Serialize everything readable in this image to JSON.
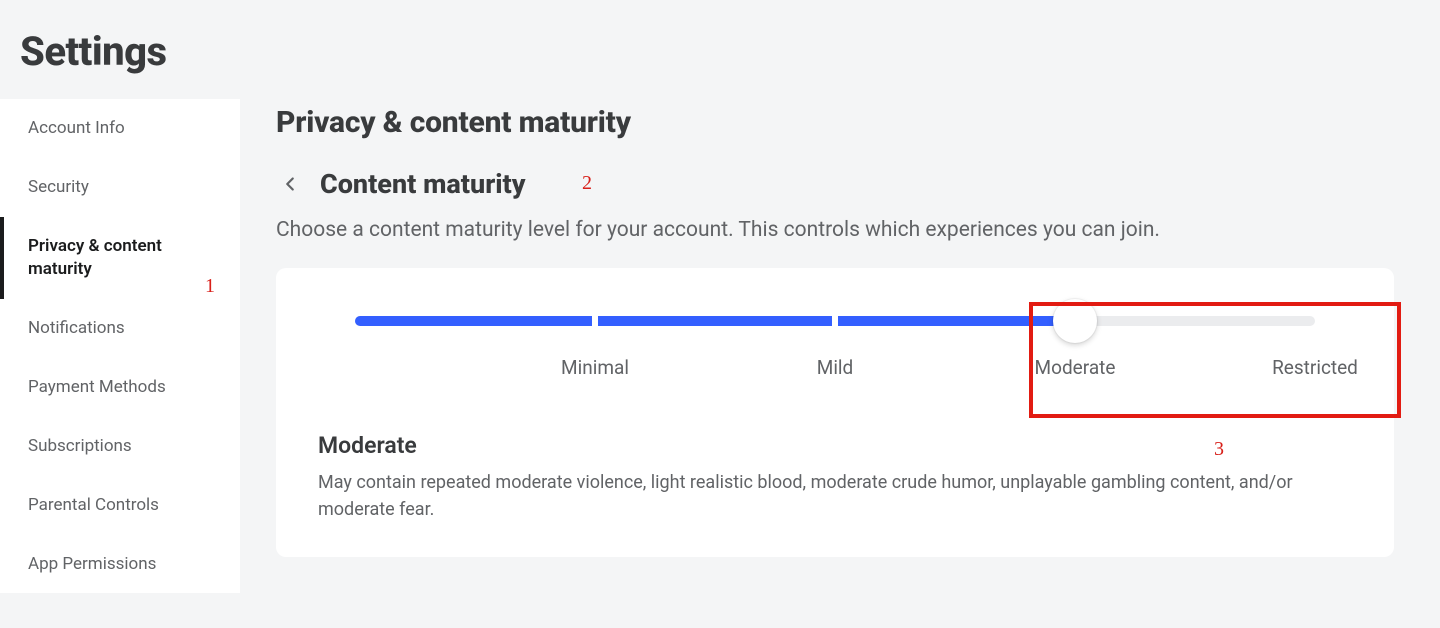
{
  "page_title": "Settings",
  "sidebar": {
    "items": [
      {
        "label": "Account Info",
        "active": false
      },
      {
        "label": "Security",
        "active": false
      },
      {
        "label": "Privacy & content maturity",
        "active": true
      },
      {
        "label": "Notifications",
        "active": false
      },
      {
        "label": "Payment Methods",
        "active": false
      },
      {
        "label": "Subscriptions",
        "active": false
      },
      {
        "label": "Parental Controls",
        "active": false
      },
      {
        "label": "App Permissions",
        "active": false
      }
    ]
  },
  "main": {
    "section_title": "Privacy & content maturity",
    "subheader_title": "Content maturity",
    "description": "Choose a content maturity level for your account. This controls which experiences you can join.",
    "slider": {
      "stops": [
        "Minimal",
        "Mild",
        "Moderate",
        "Restricted"
      ],
      "selected_index": 2,
      "selected_label": "Moderate"
    },
    "current_level_title": "Moderate",
    "current_level_description": "May contain repeated moderate violence, light realistic blood, moderate crude humor, unplayable gambling content, and/or moderate fear."
  },
  "annotations": {
    "one": "1",
    "two": "2",
    "three": "3"
  }
}
